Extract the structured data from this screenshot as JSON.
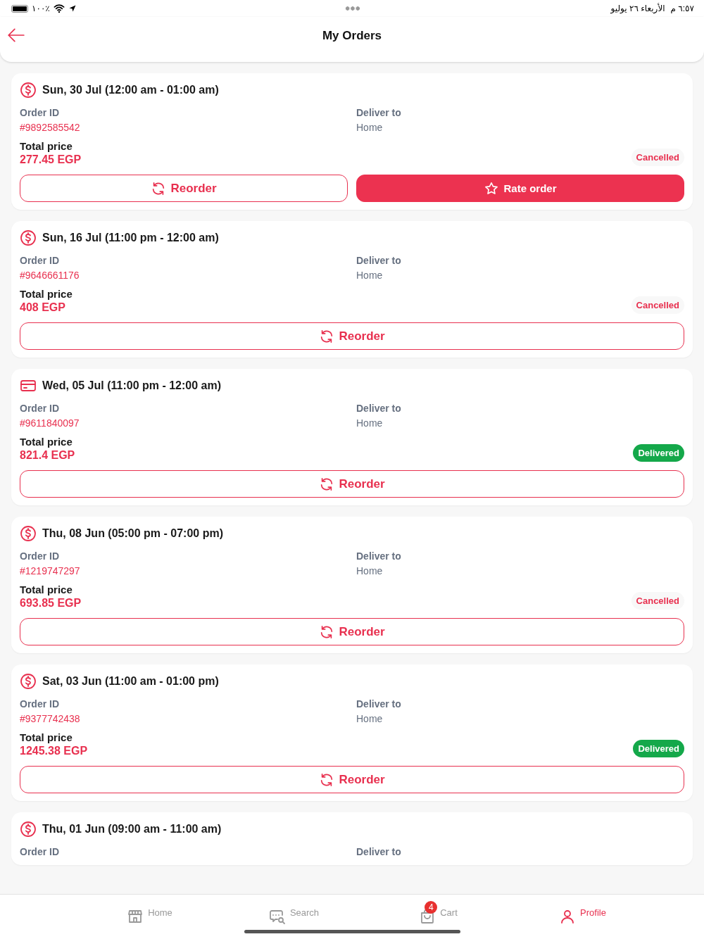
{
  "status_bar": {
    "battery": "٪١٠٠",
    "time": "٦:٥٧ م",
    "date": "الأربعاء ٢٦ يوليو"
  },
  "header": {
    "title": "My Orders"
  },
  "orders": [
    {
      "kind": "cash",
      "date": "Sun, 30 Jul (12:00 am - 01:00 am)",
      "order_id_label": "Order ID",
      "order_id": "#9892585542",
      "deliver_to_label": "Deliver to",
      "deliver_to": "Home",
      "total_label": "Total price",
      "total": "277.45 EGP",
      "status": {
        "kind": "cancelled",
        "label": "Cancelled"
      },
      "buttons": [
        {
          "kind": "reorder",
          "label": "Reorder"
        },
        {
          "kind": "rate",
          "label": "Rate order"
        }
      ]
    },
    {
      "kind": "cash",
      "date": "Sun, 16 Jul (11:00 pm - 12:00 am)",
      "order_id_label": "Order ID",
      "order_id": "#9646661176",
      "deliver_to_label": "Deliver to",
      "deliver_to": "Home",
      "total_label": "Total price",
      "total": "408 EGP",
      "status": {
        "kind": "cancelled",
        "label": "Cancelled"
      },
      "buttons": [
        {
          "kind": "reorder",
          "label": "Reorder"
        }
      ]
    },
    {
      "kind": "card",
      "date": "Wed, 05 Jul (11:00 pm - 12:00 am)",
      "order_id_label": "Order ID",
      "order_id": "#9611840097",
      "deliver_to_label": "Deliver to",
      "deliver_to": "Home",
      "total_label": "Total price",
      "total": "821.4 EGP",
      "status": {
        "kind": "delivered",
        "label": "Delivered"
      },
      "buttons": [
        {
          "kind": "reorder",
          "label": "Reorder"
        }
      ]
    },
    {
      "kind": "cash",
      "date": "Thu, 08 Jun (05:00 pm - 07:00 pm)",
      "order_id_label": "Order ID",
      "order_id": "#1219747297",
      "deliver_to_label": "Deliver to",
      "deliver_to": "Home",
      "total_label": "Total price",
      "total": "693.85 EGP",
      "status": {
        "kind": "cancelled",
        "label": "Cancelled"
      },
      "buttons": [
        {
          "kind": "reorder",
          "label": "Reorder"
        }
      ]
    },
    {
      "kind": "cash",
      "date": "Sat, 03 Jun (11:00 am - 01:00 pm)",
      "order_id_label": "Order ID",
      "order_id": "#9377742438",
      "deliver_to_label": "Deliver to",
      "deliver_to": "Home",
      "total_label": "Total price",
      "total": "1245.38 EGP",
      "status": {
        "kind": "delivered",
        "label": "Delivered"
      },
      "buttons": [
        {
          "kind": "reorder",
          "label": "Reorder"
        }
      ]
    },
    {
      "kind": "cash",
      "date": "Thu, 01 Jun (09:00 am - 11:00 am)",
      "order_id_label": "Order ID",
      "deliver_to_label": "Deliver to"
    }
  ],
  "nav": [
    {
      "kind": "home",
      "label": "Home",
      "selected": false
    },
    {
      "kind": "search",
      "label": "Search",
      "selected": false
    },
    {
      "kind": "cart",
      "label": "Cart",
      "selected": false,
      "badge": "4"
    },
    {
      "kind": "profile",
      "label": "Profile",
      "selected": true
    }
  ]
}
